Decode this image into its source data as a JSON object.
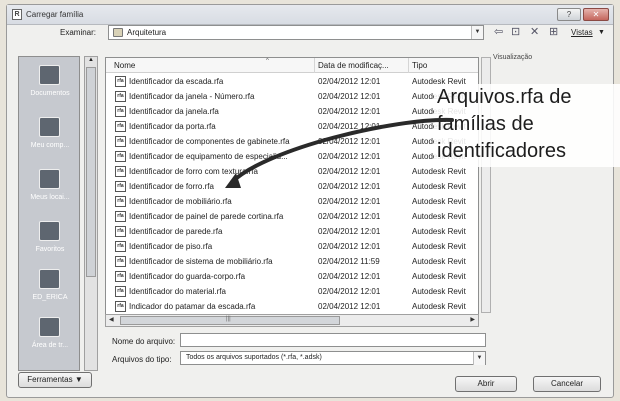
{
  "window": {
    "title": "Carregar família",
    "help_label": "?",
    "close_label": "✕"
  },
  "toolbar": {
    "look_in_label": "Examinar:",
    "look_in_value": "Arquitetura",
    "back_icon": "back-arrow-icon",
    "up_folder_icon": "up-folder-icon",
    "delete_icon": "delete-icon",
    "new_folder_icon": "new-folder-icon",
    "views_label": "Vistas",
    "preview_label": "Visualização"
  },
  "places": [
    {
      "label": "Documentos"
    },
    {
      "label": "Meu comp..."
    },
    {
      "label": "Meus locai..."
    },
    {
      "label": "Favoritos"
    },
    {
      "label": "ED_ERICA"
    },
    {
      "label": "Área de tr..."
    }
  ],
  "file_list": {
    "columns": [
      "Nome",
      "Data de modificaç...",
      "Tipo"
    ],
    "rows": [
      {
        "name": "Identificador da escada.rfa",
        "date": "02/04/2012 12:01",
        "type": "Autodesk Revit"
      },
      {
        "name": "Identificador da janela - Número.rfa",
        "date": "02/04/2012 12:01",
        "type": "Autodesk Revit"
      },
      {
        "name": "Identificador da janela.rfa",
        "date": "02/04/2012 12:01",
        "type": "Autodesk Revit"
      },
      {
        "name": "Identificador da porta.rfa",
        "date": "02/04/2012 12:01",
        "type": "Autodesk Revit"
      },
      {
        "name": "Identificador de componentes de gabinete.rfa",
        "date": "02/04/2012 12:01",
        "type": "Autodesk Revit"
      },
      {
        "name": "Identificador de equipamento de especialid...",
        "date": "02/04/2012 12:01",
        "type": "Autodesk Revit"
      },
      {
        "name": "Identificador de forro com textura.rfa",
        "date": "02/04/2012 12:01",
        "type": "Autodesk Revit"
      },
      {
        "name": "Identificador de forro.rfa",
        "date": "02/04/2012 12:01",
        "type": "Autodesk Revit"
      },
      {
        "name": "Identificador de mobiliário.rfa",
        "date": "02/04/2012 12:01",
        "type": "Autodesk Revit"
      },
      {
        "name": "Identificador de painel de parede cortina.rfa",
        "date": "02/04/2012 12:01",
        "type": "Autodesk Revit"
      },
      {
        "name": "Identificador de parede.rfa",
        "date": "02/04/2012 12:01",
        "type": "Autodesk Revit"
      },
      {
        "name": "Identificador de piso.rfa",
        "date": "02/04/2012 12:01",
        "type": "Autodesk Revit"
      },
      {
        "name": "Identificador de sistema de mobiliário.rfa",
        "date": "02/04/2012 11:59",
        "type": "Autodesk Revit"
      },
      {
        "name": "Identificador do guarda-corpo.rfa",
        "date": "02/04/2012 12:01",
        "type": "Autodesk Revit"
      },
      {
        "name": "Identificador do material.rfa",
        "date": "02/04/2012 12:01",
        "type": "Autodesk Revit"
      },
      {
        "name": "Indicador do patamar da escada.rfa",
        "date": "02/04/2012 12:01",
        "type": "Autodesk Revit"
      }
    ],
    "file_icon_text": "rfa"
  },
  "footer": {
    "file_name_label": "Nome do arquivo:",
    "file_name_value": "",
    "file_type_label": "Arquivos do tipo:",
    "file_type_value": "Todos os arquivos suportados  (*.rfa, *.adsk)",
    "tools_label": "Ferramentas",
    "open_label": "Abrir",
    "cancel_label": "Cancelar"
  },
  "annotation": {
    "text": "Arquivos.rfa de famílias de identificadores"
  }
}
